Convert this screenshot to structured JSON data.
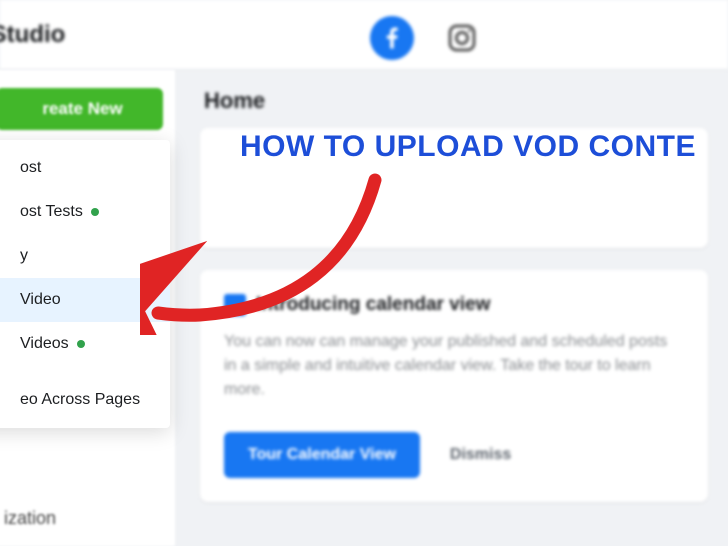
{
  "header": {
    "app_title": "or Studio",
    "platforms": {
      "facebook": "facebook-icon",
      "instagram": "instagram-icon"
    }
  },
  "sidebar": {
    "create_label": "reate New",
    "blurred_items": [
      {
        "label": "ization",
        "has_dot": false
      }
    ]
  },
  "dropdown": {
    "items": [
      {
        "label": "ost",
        "has_dot": false,
        "highlight": false
      },
      {
        "label": "ost Tests",
        "has_dot": true,
        "highlight": false
      },
      {
        "label": "y",
        "has_dot": false,
        "highlight": false
      },
      {
        "label": "Video",
        "has_dot": false,
        "highlight": true
      },
      {
        "label": "Videos",
        "has_dot": true,
        "highlight": false
      },
      {
        "label": "eo Across Pages",
        "has_dot": false,
        "highlight": false
      }
    ]
  },
  "main": {
    "page_title": "Home",
    "calendar_card": {
      "title": "Introducing calendar view",
      "body": "You can now can manage your published and scheduled posts in a simple and intuitive calendar view. Take the tour to learn more.",
      "primary_btn": "Tour Calendar View",
      "dismiss_btn": "Dismiss"
    }
  },
  "overlay": {
    "title": "HOW TO UPLOAD VOD CONTE"
  },
  "colors": {
    "accent_blue": "#1877f2",
    "create_green": "#42b72a",
    "overlay_blue": "#1d4ed8",
    "arrow_red": "#e02424"
  }
}
